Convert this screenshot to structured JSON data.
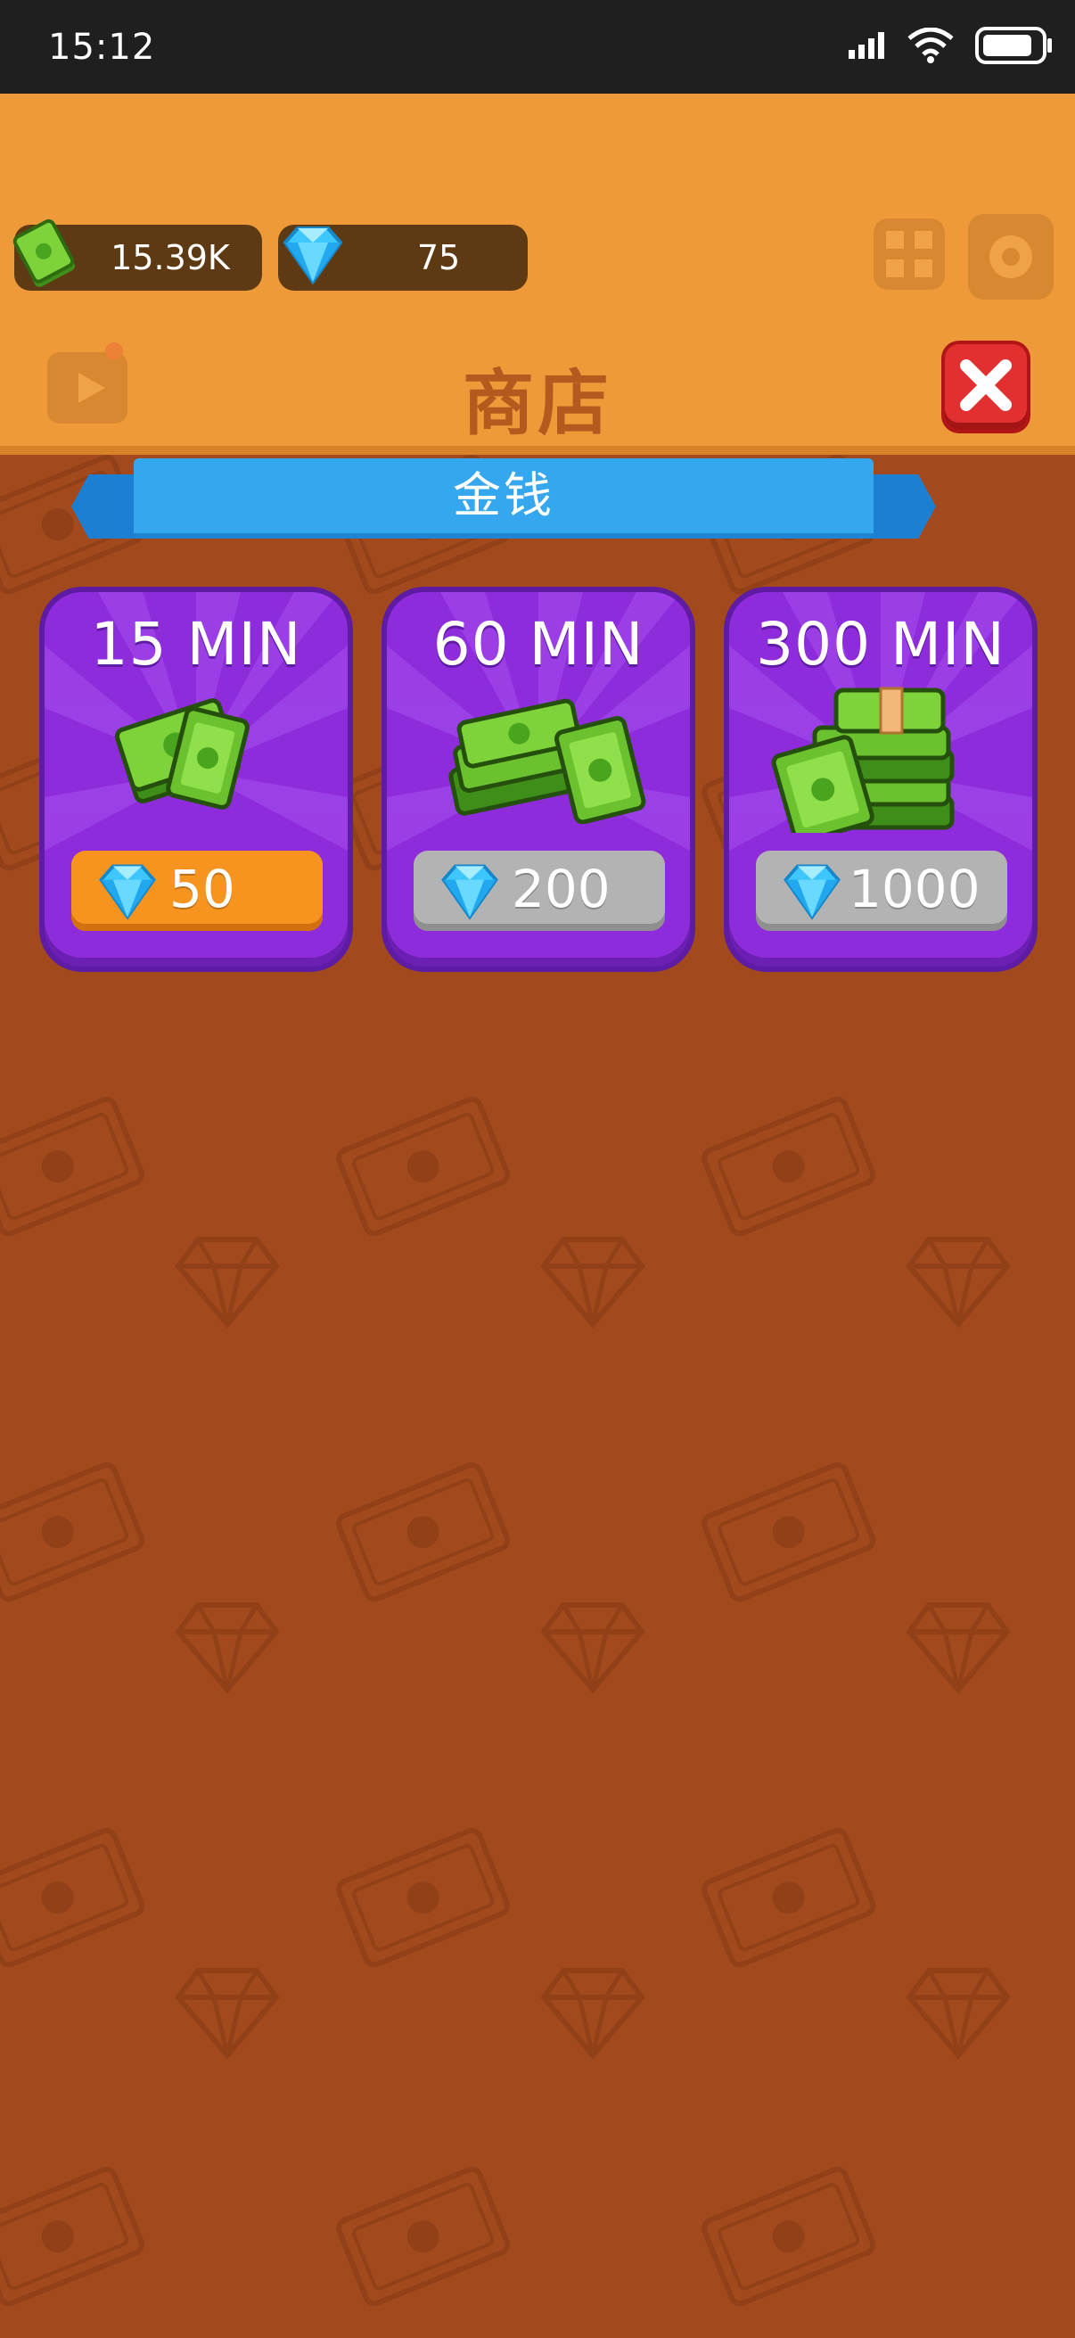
{
  "status_bar": {
    "time": "15:12"
  },
  "currency": {
    "cash": "15.39K",
    "gems": "75"
  },
  "page": {
    "title": "商店",
    "section_tab": "金钱"
  },
  "offers": [
    {
      "label": "15 MIN",
      "price": "50"
    },
    {
      "label": "60 MIN",
      "price": "200"
    },
    {
      "label": "300 MIN",
      "price": "1000"
    }
  ],
  "colors": {
    "top_band": "#ee9a39",
    "background": "#a24a1e",
    "card_purple": "#8e2bdb",
    "ribbon_blue": "#35a7ef",
    "price_affordable": "#f7941f",
    "price_locked": "#b3b3b3",
    "close_red": "#e22f2f"
  },
  "icons": [
    "cash-icon",
    "gem-icon",
    "close-icon",
    "signal-icon",
    "wifi-icon",
    "battery-icon",
    "settings-icon",
    "grid-icon",
    "video-icon"
  ]
}
